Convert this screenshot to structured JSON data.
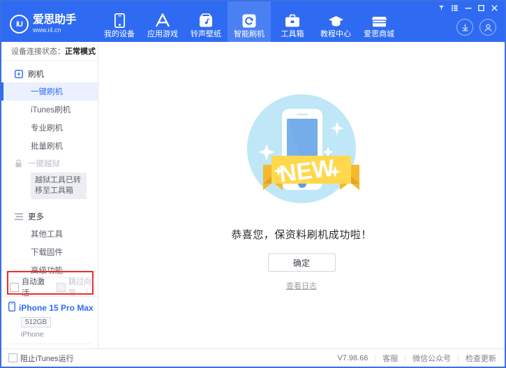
{
  "window": {
    "controls": [
      {
        "name": "pin-icon",
        "label": "▼"
      },
      {
        "name": "menu-icon",
        "label": "☰"
      },
      {
        "name": "minimize-icon",
        "label": "−"
      },
      {
        "name": "maximize-icon",
        "label": "□"
      },
      {
        "name": "close-icon",
        "label": "✕"
      }
    ]
  },
  "brand": {
    "mark": "iU",
    "name": "爱思助手",
    "url": "www.i4.cn"
  },
  "nav": {
    "items": [
      {
        "label": "我的设备",
        "icon": "phone-icon",
        "active": false
      },
      {
        "label": "应用游戏",
        "icon": "appstore-icon",
        "active": false
      },
      {
        "label": "铃声壁纸",
        "icon": "music-icon",
        "active": false
      },
      {
        "label": "智能刷机",
        "icon": "refresh-icon",
        "active": true
      },
      {
        "label": "工具箱",
        "icon": "toolbox-icon",
        "active": false
      },
      {
        "label": "教程中心",
        "icon": "graduation-cap-icon",
        "active": false
      },
      {
        "label": "爱思商城",
        "icon": "shop-icon",
        "active": false
      }
    ],
    "download_icon": "download-icon",
    "account_icon": "account-icon"
  },
  "sidebar": {
    "connection_label": "设备连接状态：",
    "connection_value": "正常模式",
    "group_flash": "刷机",
    "flash_items": [
      {
        "label": "一键刷机",
        "active": true
      },
      {
        "label": "iTunes刷机",
        "active": false
      },
      {
        "label": "专业刷机",
        "active": false
      },
      {
        "label": "批量刷机",
        "active": false
      }
    ],
    "group_jailbreak": "一键越狱",
    "jailbreak_tooltip": "越狱工具已转移至工具箱",
    "group_more": "更多",
    "more_items": [
      {
        "label": "其他工具"
      },
      {
        "label": "下载固件"
      },
      {
        "label": "高级功能"
      }
    ],
    "options": [
      {
        "label": "自动激活",
        "checked": false,
        "disabled": false
      },
      {
        "label": "跳过向导",
        "checked": false,
        "disabled": true
      }
    ],
    "device": {
      "name": "iPhone 15 Pro Max",
      "capacity": "512GB",
      "type": "iPhone",
      "icon": "phone-small-icon"
    }
  },
  "main": {
    "hero_badge": "NEW",
    "message": "恭喜您，保资料刷机成功啦！",
    "confirm_label": "确定",
    "log_link": "查看日志"
  },
  "footer": {
    "block_itunes": "阻止iTunes运行",
    "version": "V7.98.66",
    "links": [
      "客服",
      "微信公众号",
      "检查更新"
    ]
  },
  "colors": {
    "brand_blue": "#2f6bf2",
    "nav_active": "#4b80f5",
    "highlight_red": "#ee2b2b",
    "selected_bg": "#eaf0fe"
  }
}
